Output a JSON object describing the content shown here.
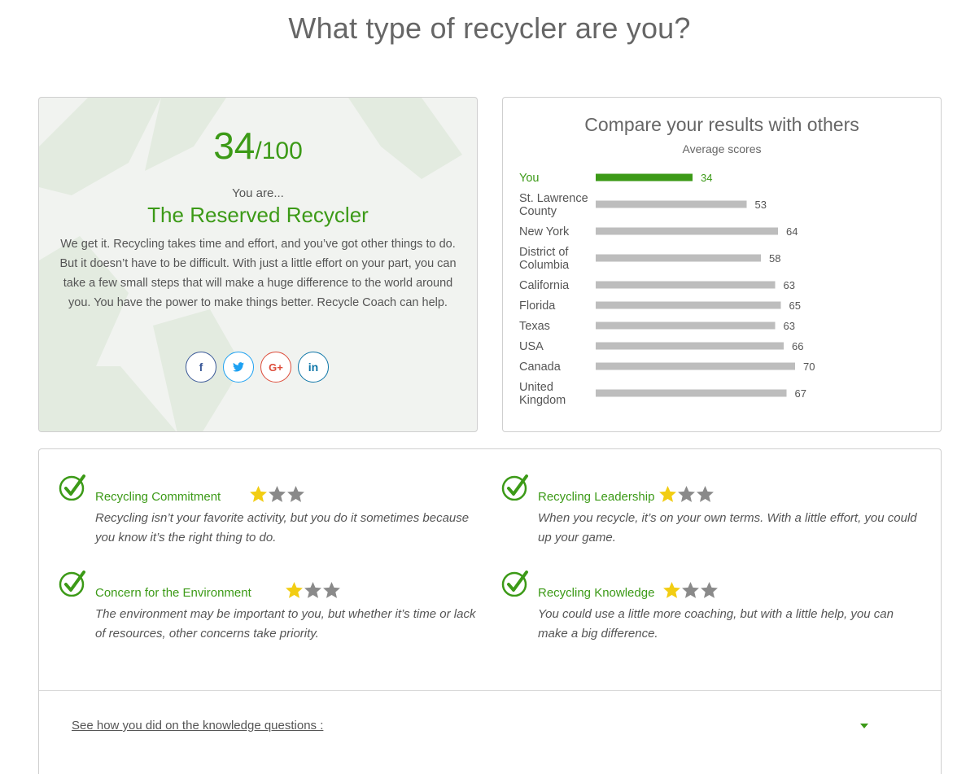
{
  "page": {
    "title": "What type of recycler are you?"
  },
  "score_card": {
    "score": "34",
    "max": "/100",
    "you_are": "You are...",
    "type_name": "The Reserved Recycler",
    "description": "We get it. Recycling takes time and effort, and you’ve got other things to do. But it doesn’t have to be difficult. With just a little effort on your part, you can take a few small steps that will make a huge difference to the world around you. You have the power to make things better. Recycle Coach can help.",
    "share": [
      {
        "name": "facebook",
        "label": "f",
        "color": "#3b5998",
        "icon": "facebook-icon"
      },
      {
        "name": "twitter",
        "label": "t",
        "color": "#1da1f2",
        "icon": "twitter-icon"
      },
      {
        "name": "google-plus",
        "label": "G+",
        "color": "#dd4b39",
        "icon": "google-plus-icon"
      },
      {
        "name": "linkedin",
        "label": "in",
        "color": "#0e76a8",
        "icon": "linkedin-icon"
      }
    ]
  },
  "compare": {
    "title": "Compare your results with others",
    "subtitle": "Average scores"
  },
  "chart_data": {
    "type": "bar",
    "orientation": "horizontal",
    "title": "Compare your results with others",
    "subtitle": "Average scores",
    "categories": [
      "You",
      "St. Lawrence County",
      "New York",
      "District of Columbia",
      "California",
      "Florida",
      "Texas",
      "USA",
      "Canada",
      "United Kingdom"
    ],
    "values": [
      34,
      53,
      64,
      58,
      63,
      65,
      63,
      66,
      70,
      67
    ],
    "xlim": [
      0,
      100
    ],
    "grid": false,
    "highlight_color": "#3c9a17",
    "bar_color": "#bdbdbd"
  },
  "traits": [
    {
      "name": "Recycling Commitment",
      "stars": 1,
      "max_stars": 3,
      "description": "Recycling isn’t your favorite activity, but you do it sometimes because you know it’s the right thing to do."
    },
    {
      "name": "Recycling Leadership",
      "stars": 1,
      "max_stars": 3,
      "description": "When you recycle, it’s on your own terms. With a little effort, you could up your game."
    },
    {
      "name": "Concern for the Environment",
      "stars": 1,
      "max_stars": 3,
      "description": "The environment may be important to you, but whether it’s time or lack of resources, other concerns take priority."
    },
    {
      "name": "Recycling Knowledge",
      "stars": 1,
      "max_stars": 3,
      "description": "You could use a little more coaching, but with a little help, you can make a big difference."
    }
  ],
  "knowledge": {
    "link_text": "See how you did on the knowledge questions :"
  },
  "colors": {
    "accent": "#3c9a17",
    "star_filled": "#f2cd13",
    "star_empty": "#8a8a8a"
  }
}
